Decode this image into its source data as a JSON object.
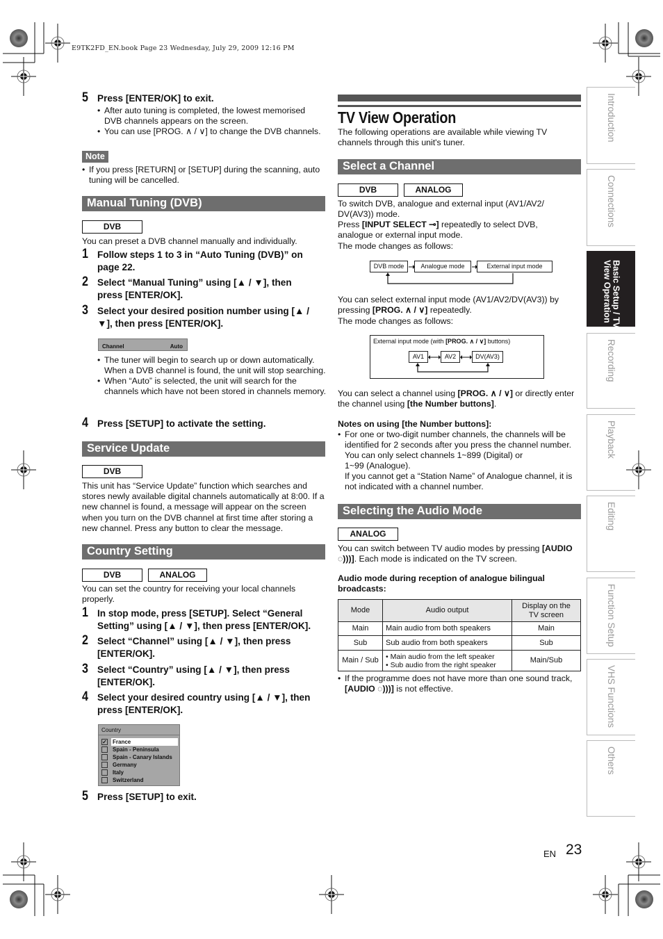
{
  "print_header": "E9TK2FD_EN.book  Page 23  Wednesday, July 29, 2009  12:16 PM",
  "left_column": {
    "step5_top": {
      "num": "5",
      "text": "Press [ENTER/OK] to exit."
    },
    "step5_bullets": [
      "After auto tuning is completed, the lowest memorised DVB channels appears on the screen.",
      "You can use [PROG. ∧ / ∨] to change the DVB channels."
    ],
    "note_label": "Note",
    "note_bullets": [
      "If you press [RETURN] or [SETUP] during the scanning, auto tuning will be cancelled."
    ],
    "manual_tuning": {
      "title": "Manual Tuning (DVB)",
      "tags": [
        "DVB"
      ],
      "intro": "You can preset a DVB channel manually and individually.",
      "steps": [
        {
          "num": "1",
          "text": "Follow steps 1 to 3 in “Auto Tuning (DVB)” on page 22."
        },
        {
          "num": "2",
          "text": "Select “Manual Tuning” using [▲ / ▼], then press [ENTER/OK]."
        },
        {
          "num": "3",
          "text": "Select your desired position number using [▲ / ▼], then press [ENTER/OK]."
        }
      ],
      "osd": {
        "label": "Channel",
        "value": "Auto"
      },
      "bullets": [
        "The tuner will begin to search up or down automatically. When a DVB channel is found, the unit will stop searching.",
        "When “Auto” is selected, the unit will search for the channels which have not been stored in channels memory."
      ],
      "step4": {
        "num": "4",
        "text": "Press [SETUP] to activate the setting."
      }
    },
    "service_update": {
      "title": "Service Update",
      "tags": [
        "DVB"
      ],
      "body": "This unit has “Service Update” function which searches and stores newly available digital channels automatically at 8:00. If a new channel is found, a message will appear on the screen when you turn on the DVB channel at first time after storing a new channel. Press any button to clear the message."
    },
    "country_setting": {
      "title": "Country Setting",
      "tags": [
        "DVB",
        "ANALOG"
      ],
      "intro": "You can set the country for receiving your local channels properly.",
      "steps": [
        {
          "num": "1",
          "text": "In stop mode, press [SETUP]. Select “General Setting” using [▲ / ▼], then press [ENTER/OK]."
        },
        {
          "num": "2",
          "text": "Select “Channel” using [▲ / ▼], then press [ENTER/OK]."
        },
        {
          "num": "3",
          "text": "Select “Country” using [▲ / ▼], then press [ENTER/OK]."
        },
        {
          "num": "4",
          "text": "Select your desired country using [▲ / ▼], then press [ENTER/OK]."
        }
      ],
      "osd": {
        "title": "Country",
        "items": [
          {
            "label": "France",
            "checked": true
          },
          {
            "label": "Spain - Peninsula",
            "checked": false
          },
          {
            "label": "Spain - Canary Islands",
            "checked": false
          },
          {
            "label": "Germany",
            "checked": false
          },
          {
            "label": "Italy",
            "checked": false
          },
          {
            "label": "Switzerland",
            "checked": false
          }
        ]
      },
      "step5": {
        "num": "5",
        "text": "Press [SETUP] to exit."
      }
    }
  },
  "right_column": {
    "title": "TV View Operation",
    "intro": "The following operations are available while viewing TV channels through this unit's tuner.",
    "select_channel": {
      "title": "Select a Channel",
      "tags": [
        "DVB",
        "ANALOG"
      ],
      "p1": "To switch DVB, analogue and external input (AV1/AV2/ DV(AV3)) mode.",
      "p2_prefix": "Press ",
      "p2_bold": "[INPUT SELECT ⊸]",
      "p2_suffix": " repeatedly to select DVB, analogue or external input mode.",
      "p3": "The mode changes as follows:",
      "flow1": [
        "DVB mode",
        "Analogue mode",
        "External input mode"
      ],
      "p4_prefix": "You can select external input mode (AV1/AV2/DV(AV3)) by pressing ",
      "p4_bold": "[PROG. ∧ / ∨]",
      "p4_suffix": " repeatedly.",
      "p5": "The mode changes as follows:",
      "flow2_caption_prefix": "External input mode (with ",
      "flow2_caption_bold": "[PROG. ∧ / ∨]",
      "flow2_caption_suffix": " buttons)",
      "flow2": [
        "AV1",
        "AV2",
        "DV(AV3)"
      ],
      "p6_a": "You can select a channel using ",
      "p6_b": "[PROG. ∧ / ∨]",
      "p6_c": " or directly enter the channel using ",
      "p6_d": "[the Number buttons]",
      "p6_e": ".",
      "notes_heading": "Notes on using [the Number buttons]:",
      "notes_bullet": "For one or two-digit number channels, the channels will be identified for 2 seconds after you press the channel number.",
      "notes_line2": "You can only select channels 1~899 (Digital) or",
      "notes_line3": "1~99 (Analogue).",
      "notes_line4": "If you cannot get a “Station Name” of Analogue channel, it is not indicated with a channel number."
    },
    "audio_mode": {
      "title": "Selecting the Audio Mode",
      "tags": [
        "ANALOG"
      ],
      "p1_a": "You can switch between TV audio modes by pressing ",
      "p1_b": "[AUDIO ◌)))]",
      "p1_c": ". Each mode is indicated on the TV screen.",
      "table_heading": "Audio mode during reception of analogue bilingual broadcasts:",
      "table": {
        "headers": [
          "Mode",
          "Audio output",
          "Display on the TV screen"
        ],
        "rows": [
          {
            "mode": "Main",
            "output": [
              "Main audio from both speakers"
            ],
            "display": "Main"
          },
          {
            "mode": "Sub",
            "output": [
              "Sub audio from both speakers"
            ],
            "display": "Sub"
          },
          {
            "mode": "Main / Sub",
            "output": [
              "• Main audio from the left speaker",
              "• Sub audio from the right speaker"
            ],
            "display": "Main/Sub"
          }
        ]
      },
      "footnote_a": "If the programme does not have more than one sound track, ",
      "footnote_b": "[AUDIO ◌)))]",
      "footnote_c": " is not effective."
    }
  },
  "side_tabs": [
    {
      "label": "Introduction",
      "active": false
    },
    {
      "label": "Connections",
      "active": false
    },
    {
      "label": "Basic Setup / TV View Operation",
      "active": true
    },
    {
      "label": "Recording",
      "active": false
    },
    {
      "label": "Playback",
      "active": false
    },
    {
      "label": "Editing",
      "active": false
    },
    {
      "label": "Function Setup",
      "active": false
    },
    {
      "label": "VHS Functions",
      "active": false
    },
    {
      "label": "Others",
      "active": false
    }
  ],
  "footer": {
    "lang": "EN",
    "page_number": "23"
  }
}
